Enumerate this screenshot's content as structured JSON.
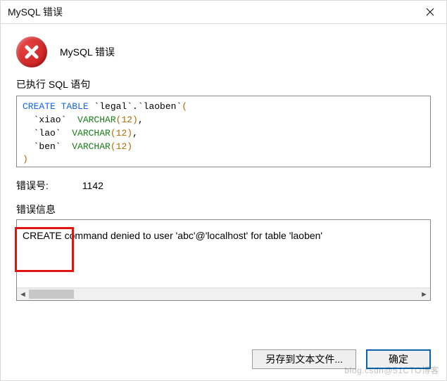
{
  "window": {
    "title": "MySQL 错误"
  },
  "heading": "MySQL 错误",
  "sql_label": "已执行 SQL 语句",
  "sql": {
    "kw_create": "CREATE TABLE",
    "table_ref": " `legal`.`laoben`",
    "open_paren": "(",
    "cols": [
      {
        "name": "  `xiao` ",
        "type": " VARCHAR",
        "len": "(12)",
        "comma": ","
      },
      {
        "name": "  `lao` ",
        "type": " VARCHAR",
        "len": "(12)",
        "comma": ","
      },
      {
        "name": "  `ben` ",
        "type": " VARCHAR",
        "len": "(12)",
        "comma": ""
      }
    ],
    "close_paren": ")"
  },
  "errno_label": "错误号:",
  "errno_value": "1142",
  "errmsg_label": "错误信息",
  "errmsg_text": "CREATE command denied to user 'abc'@'localhost' for table 'laoben'",
  "buttons": {
    "save": "另存到文本文件...",
    "ok": "确定"
  },
  "watermark": "blog.csdn@51CTO博客"
}
